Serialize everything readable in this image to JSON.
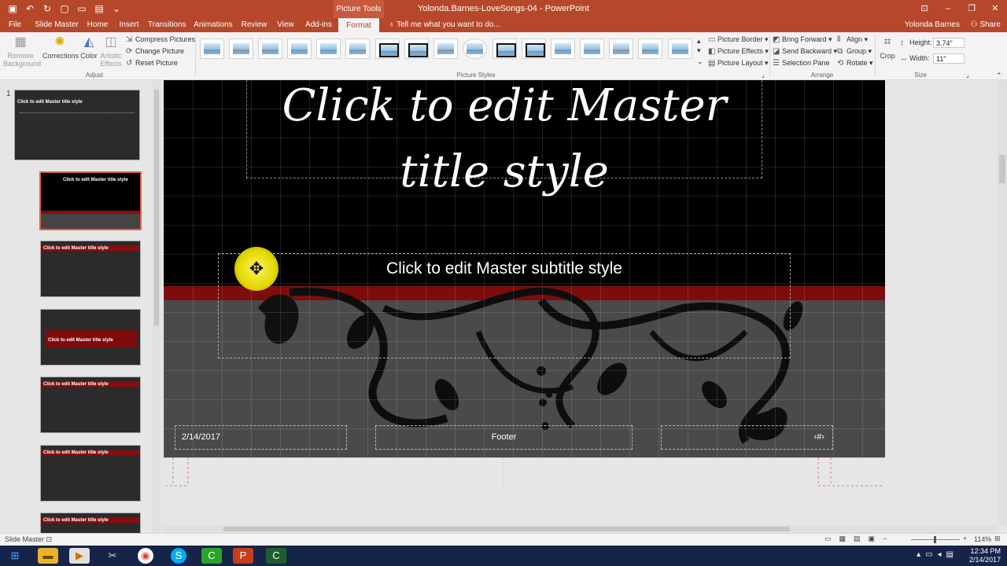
{
  "titlebar": {
    "context_tab": "Picture Tools",
    "doc_title": "Yolonda.Barnes-LoveSongs-04 - PowerPoint",
    "qat_icons": [
      "save-icon",
      "undo-icon",
      "redo-icon",
      "new-icon",
      "open-icon",
      "print-icon"
    ]
  },
  "tabs": [
    {
      "label": "File"
    },
    {
      "label": "Slide Master"
    },
    {
      "label": "Home"
    },
    {
      "label": "Insert"
    },
    {
      "label": "Transitions"
    },
    {
      "label": "Animations"
    },
    {
      "label": "Review"
    },
    {
      "label": "View"
    },
    {
      "label": "Add-ins"
    },
    {
      "label": "Format",
      "active": true
    }
  ],
  "tell_me": "Tell me what you want to do...",
  "user": "Yolonda Barnes",
  "share": "Share",
  "ribbon": {
    "adjust": {
      "remove_background": "Remove Background",
      "corrections": "Corrections",
      "color": "Color",
      "artistic_effects": "Artistic Effects",
      "compress": "Compress Pictures",
      "change": "Change Picture",
      "reset": "Reset Picture",
      "label": "Adjust"
    },
    "picture_styles_label": "Picture Styles",
    "styles_count_note": "",
    "format_cmds": {
      "border": "Picture Border",
      "effects": "Picture Effects",
      "layout": "Picture Layout"
    },
    "arrange": {
      "bring_forward": "Bring Forward",
      "send_backward": "Send Backward",
      "selection_pane": "Selection Pane",
      "align": "Align",
      "group": "Group",
      "rotate": "Rotate",
      "label": "Arrange"
    },
    "size": {
      "crop": "Crop",
      "height_label": "Height:",
      "height_value": "3.74\"",
      "width_label": "Width:",
      "width_value": "11\"",
      "label": "Size"
    }
  },
  "thumbnails": {
    "number": "1",
    "items": [
      {
        "title": "Click to edit Master title style"
      },
      {
        "title": "Click to edit Master title style"
      },
      {
        "title": "Click to edit Master title style"
      },
      {
        "title": "Click to edit Master title style"
      },
      {
        "title": "Click to edit Master title style"
      },
      {
        "title": "Click to edit Master title style"
      },
      {
        "title": "Click to edit Master title style"
      }
    ]
  },
  "slide": {
    "title": "Click to edit Master title style",
    "subtitle": "Click to edit Master subtitle style",
    "date": "2/14/2017",
    "footer": "Footer",
    "slide_number": "‹#›"
  },
  "statusbar": {
    "mode": "Slide Master",
    "zoom": "114%"
  },
  "taskbar": {
    "time": "12:34 PM",
    "date": "2/14/2017"
  },
  "colors": {
    "accent": "#b7472a",
    "slide_band_red": "#7e0c0c",
    "slide_gray": "#4a4a4a",
    "taskbar": "#16244a"
  }
}
